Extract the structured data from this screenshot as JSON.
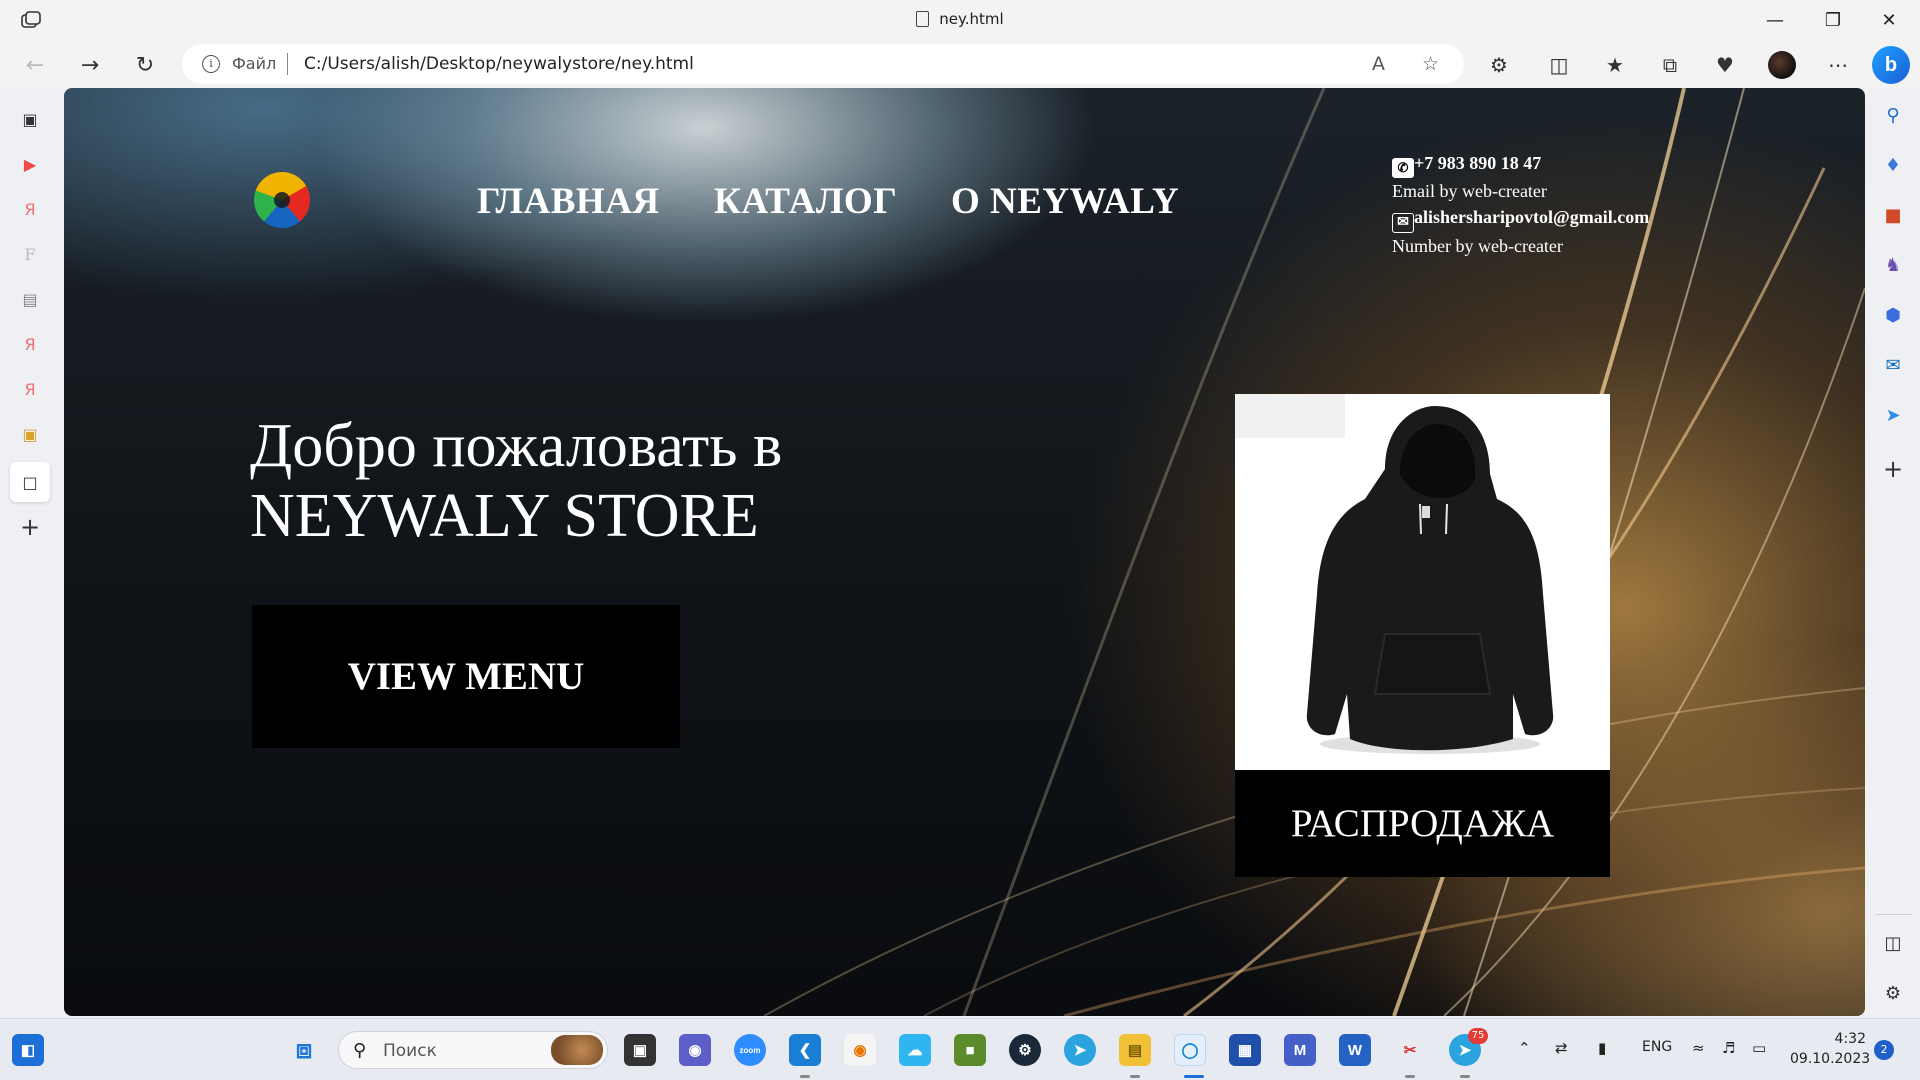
{
  "browser": {
    "tab_title": "ney.html",
    "address_file_label": "Файл",
    "address_url": "C:/Users/alish/Desktop/neywalystore/ney.html",
    "read_aloud_label": "A",
    "bing_label": "b"
  },
  "page": {
    "nav": [
      "ГЛАВНАЯ",
      "КАТАЛОГ",
      "О NEYWALY"
    ],
    "contacts": {
      "phone": "+7 983 890 18 47",
      "email_caption": "Email by web-creater",
      "email": "alishersharipovtol@gmail.com",
      "number_caption": "Number by web-creater"
    },
    "hero": {
      "line1": "Добро пожаловать в",
      "line2": "NEYWALY STORE"
    },
    "view_menu_button": "VIEW MENU",
    "sale_label": "РАСПРОДАЖА"
  },
  "taskbar": {
    "search_placeholder": "Поиск",
    "language": "ENG",
    "time": "4:32",
    "date": "09.10.2023",
    "notification_count": "2",
    "telegram_badge": "75",
    "zoom_label": "zoom"
  }
}
